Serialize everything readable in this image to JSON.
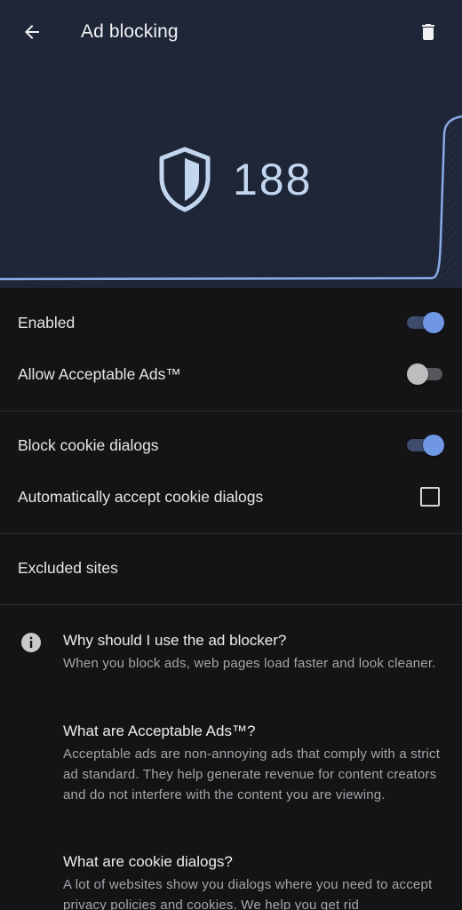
{
  "colors": {
    "hero_bg": "#1e2638",
    "accent": "#6f97e4",
    "graph_line": "#8aa9e6",
    "body_bg": "#141416"
  },
  "appbar": {
    "title": "Ad blocking",
    "back_icon": "arrow-left-icon",
    "delete_icon": "trash-icon"
  },
  "stats": {
    "blocked_count": "188",
    "icon": "shield-icon"
  },
  "settings": {
    "enabled": {
      "label": "Enabled",
      "checked": true
    },
    "acceptable_ads": {
      "label": "Allow Acceptable Ads™",
      "checked": false
    },
    "block_cookie": {
      "label": "Block cookie dialogs",
      "checked": true
    },
    "auto_accept_cookie": {
      "label": "Automatically accept cookie dialogs",
      "checked": false
    },
    "excluded_sites": {
      "label": "Excluded sites"
    }
  },
  "info": {
    "icon": "info-icon",
    "faq": [
      {
        "question": "Why should I use the ad blocker?",
        "answer": "When you block ads, web pages load faster and look cleaner."
      },
      {
        "question": "What are Acceptable Ads™?",
        "answer": "Acceptable ads are non-annoying ads that comply with a strict ad standard. They help generate revenue for content creators and do not interfere with the content you are viewing."
      },
      {
        "question": "What are cookie dialogs?",
        "answer": "A lot of websites show you dialogs where you need to accept privacy policies and cookies. We help you get rid"
      }
    ]
  }
}
